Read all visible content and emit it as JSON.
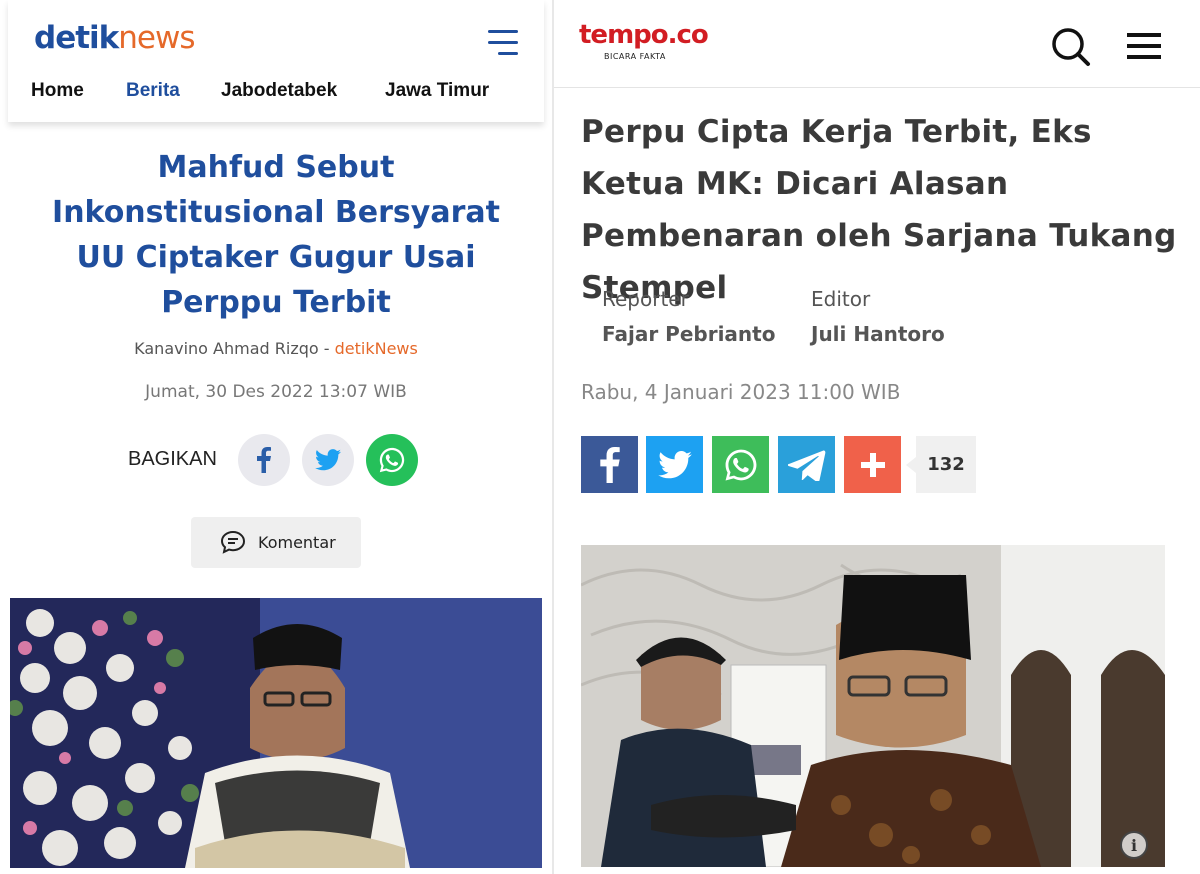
{
  "detik": {
    "logo_main": "detik",
    "logo_accent": "news",
    "nav": [
      "Home",
      "Berita",
      "Jabodetabek",
      "Jawa Timur"
    ],
    "title": "Mahfud Sebut Inkonstitusional Bersyarat UU Ciptaker Gugur Usai Perppu Terbit",
    "author": "Kanavino Ahmad Rizqo",
    "byline_sep": " - ",
    "source": "detikNews",
    "date": "Jumat, 30 Des 2022 13:07 WIB",
    "share_label": "BAGIKAN",
    "comment_label": "Komentar",
    "colors": {
      "brand": "#1f4e9d",
      "accent": "#e5692a",
      "whatsapp": "#25c05a"
    }
  },
  "tempo": {
    "logo": "tempo.co",
    "tagline": "BICARA FAKTA",
    "title": "Perpu Cipta Kerja Terbit, Eks Ketua MK: Dicari Alasan Pembenaran oleh Sarjana Tukang Stempel",
    "reporter_label": "Reporter",
    "reporter_name": "Fajar Pebrianto",
    "editor_label": "Editor",
    "editor_name": "Juli Hantoro",
    "date": "Rabu, 4 Januari 2023 11:00 WIB",
    "share_count": "132",
    "share_icons": [
      "facebook-icon",
      "twitter-icon",
      "whatsapp-icon",
      "telegram-icon",
      "plus-icon"
    ],
    "colors": {
      "brand": "#d21d23",
      "facebook": "#3b5998",
      "twitter": "#1da1f2",
      "whatsapp": "#3ebd5a",
      "telegram": "#2aa0da",
      "plus": "#f0614a"
    }
  }
}
